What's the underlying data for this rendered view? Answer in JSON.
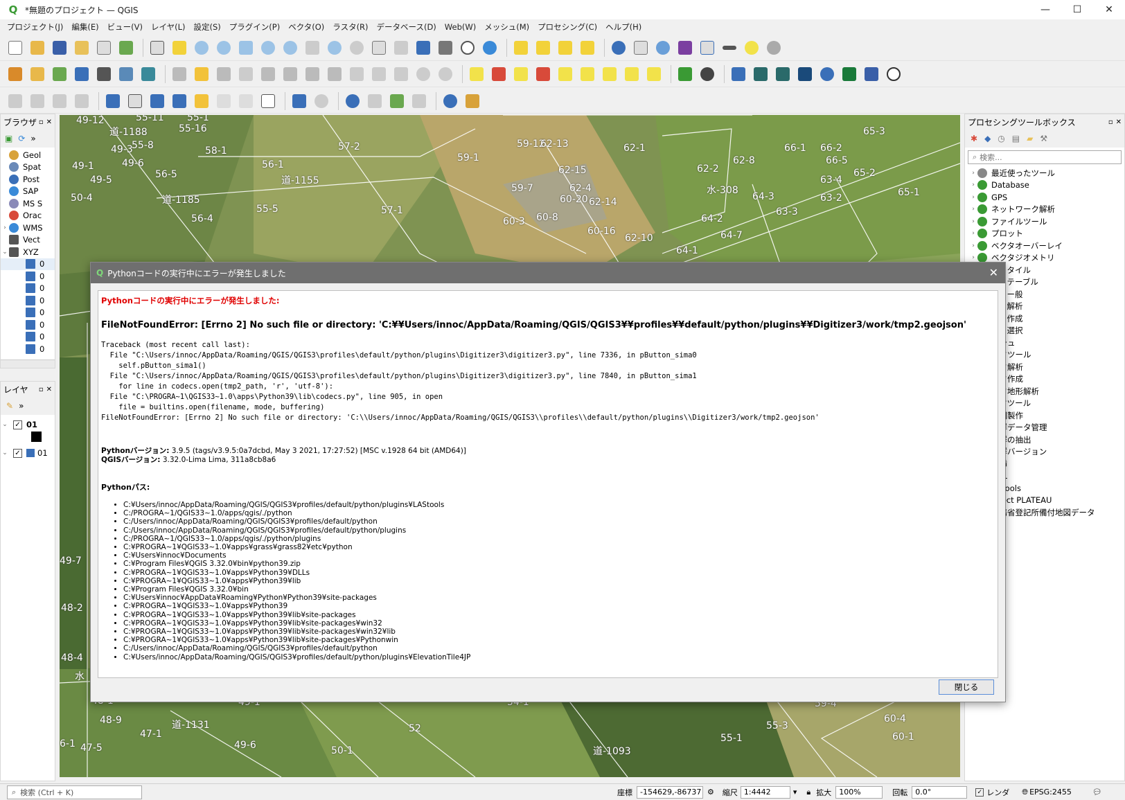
{
  "window": {
    "title": "*無題のプロジェクト — QGIS",
    "minimize": "—",
    "maximize": "☐",
    "close": "✕"
  },
  "menu": [
    "プロジェクト(J)",
    "編集(E)",
    "ビュー(V)",
    "レイヤ(L)",
    "設定(S)",
    "プラグイン(P)",
    "ベクタ(O)",
    "ラスタ(R)",
    "データベース(D)",
    "Web(W)",
    "メッシュ(M)",
    "プロセシング(C)",
    "ヘルプ(H)"
  ],
  "browser": {
    "title": "ブラウザ",
    "items": [
      "Geol",
      "Spat",
      "Post",
      "SAP",
      "MS S",
      "Orac",
      "WMS",
      "Vect",
      "XYZ"
    ],
    "xyz_children": [
      "0",
      "0",
      "0",
      "0",
      "0",
      "0",
      "0",
      "0"
    ]
  },
  "layers": {
    "title": "レイヤ",
    "items": [
      "01",
      "01"
    ]
  },
  "processing": {
    "title": "プロセシングツールボックス",
    "search_placeholder": "検索...",
    "items": [
      "最近使ったツール",
      "Database",
      "GPS",
      "ネットワーク解析",
      "ファイルツール",
      "プロット",
      "ベクタオーバーレイ",
      "ベクタジオメトリ",
      "クタタイル",
      "クタテーブル",
      "クター般",
      "クタ解析",
      "クタ作成",
      "クタ選択",
      "ッシュ",
      "スタツール",
      "スタ解析",
      "スタ作成",
      "スタ地形解析",
      "イヤツール",
      "地図製作",
      "点群データ管理",
      "点群の抽出",
      "点群バージョン",
      "内挿",
      "DAL",
      "AStools",
      "roject PLATEAU",
      "法務省登記所備付地図データ"
    ]
  },
  "map_labels": [
    "49-12",
    "道-1188",
    "55-11",
    "55-1",
    "55-16",
    "49-3",
    "55-8",
    "58-1",
    "57-2",
    "59-1",
    "59-12",
    "62-13",
    "62-1",
    "66-1",
    "66-2",
    "65-3",
    "49-1",
    "49-6",
    "56-1",
    "49-5",
    "56-5",
    "道-1155",
    "62-15",
    "62-2",
    "62-8",
    "66-5",
    "65-2",
    "59-7",
    "62-4",
    "水-308",
    "64-3",
    "63-4",
    "65-1",
    "50-4",
    "道-1185",
    "55-5",
    "57-1",
    "60-20",
    "62-14",
    "63-2",
    "63-3",
    "56-4",
    "60-3",
    "60-8",
    "60-16",
    "64-2",
    "62-10",
    "64-7",
    "64-1",
    "49-7",
    "48-2",
    "48-4",
    "水",
    "48-1",
    "49-1",
    "道-1079",
    "56-2",
    "54-1",
    "59-3",
    "59-4",
    "48-9",
    "47-1",
    "道-1131",
    "52",
    "55-3",
    "60-4",
    "55-1",
    "60-1",
    "49-6",
    "6-1",
    "47-5",
    "50-1",
    "道-1093"
  ],
  "dialog": {
    "title": "Pythonコードの実行中にエラーが発生しました",
    "header": "Pythonコードの実行中にエラーが発生しました:",
    "error": "FileNotFoundError: [Errno 2] No such file or directory: 'C:¥¥Users/innoc/AppData/Roaming/QGIS/QGIS3¥¥profiles¥¥default/python/plugins¥¥Digitizer3/work/tmp2.geojson'",
    "traceback": "Traceback (most recent call last):\n  File \"C:\\Users/innoc/AppData/Roaming/QGIS/QGIS3\\profiles\\default/python/plugins\\Digitizer3\\digitizer3.py\", line 7336, in pButton_sima0\n    self.pButton_sima1()\n  File \"C:\\Users/innoc/AppData/Roaming/QGIS/QGIS3\\profiles\\default/python/plugins\\Digitizer3\\digitizer3.py\", line 7840, in pButton_sima1\n    for line in codecs.open(tmp2_path, 'r', 'utf-8'):\n  File \"C:\\PROGRA~1\\QGIS33~1.0\\apps\\Python39\\lib\\codecs.py\", line 905, in open\n    file = builtins.open(filename, mode, buffering)\nFileNotFoundError: [Errno 2] No such file or directory: 'C:\\\\Users/innoc/AppData/Roaming/QGIS/QGIS3\\\\profiles\\\\default/python/plugins\\\\Digitizer3/work/tmp2.geojson'",
    "python_version_label": "Pythonバージョン:",
    "python_version": "3.9.5 (tags/v3.9.5:0a7dcbd, May  3 2021, 17:27:52) [MSC v.1928 64 bit (AMD64)]",
    "qgis_version_label": "QGISバージョン:",
    "qgis_version": "3.32.0-Lima Lima, 311a8cb8a6",
    "python_path_label": "Pythonパス:",
    "python_paths": [
      "C:¥Users/innoc/AppData/Roaming/QGIS/QGIS3¥profiles/default/python/plugins¥LAStools",
      "C:/PROGRA~1/QGIS33~1.0/apps/qgis/./python",
      "C:/Users/innoc/AppData/Roaming/QGIS/QGIS3¥profiles/default/python",
      "C:/Users/innoc/AppData/Roaming/QGIS/QGIS3¥profiles/default/python/plugins",
      "C:/PROGRA~1/QGIS33~1.0/apps/qgis/./python/plugins",
      "C:¥PROGRA~1¥QGIS33~1.0¥apps¥grass¥grass82¥etc¥python",
      "C:¥Users¥innoc¥Documents",
      "C:¥Program Files¥QGIS 3.32.0¥bin¥python39.zip",
      "C:¥PROGRA~1¥QGIS33~1.0¥apps¥Python39¥DLLs",
      "C:¥PROGRA~1¥QGIS33~1.0¥apps¥Python39¥lib",
      "C:¥Program Files¥QGIS 3.32.0¥bin",
      "C:¥Users¥innoc¥AppData¥Roaming¥Python¥Python39¥site-packages",
      "C:¥PROGRA~1¥QGIS33~1.0¥apps¥Python39",
      "C:¥PROGRA~1¥QGIS33~1.0¥apps¥Python39¥lib¥site-packages",
      "C:¥PROGRA~1¥QGIS33~1.0¥apps¥Python39¥lib¥site-packages¥win32",
      "C:¥PROGRA~1¥QGIS33~1.0¥apps¥Python39¥lib¥site-packages¥win32¥lib",
      "C:¥PROGRA~1¥QGIS33~1.0¥apps¥Python39¥lib¥site-packages¥Pythonwin",
      "C:/Users/innoc/AppData/Roaming/QGIS/QGIS3¥profiles/default/python",
      "C:¥Users/innoc/AppData/Roaming/QGIS/QGIS3¥profiles/default/python/plugins¥ElevationTile4JP"
    ],
    "close_button": "閉じる",
    "title_close": "✕"
  },
  "status": {
    "search_placeholder": "検索 (Ctrl + K)",
    "coord_label": "座標",
    "coord_value": "-154629,-86737",
    "scale_label": "縮尺",
    "scale_value": "1:4442",
    "zoom_label": "拡大",
    "zoom_value": "100%",
    "rotation_label": "回転",
    "rotation_value": "0.0°",
    "render_label": "レンダ",
    "crs": "EPSG:2455"
  },
  "colors": {
    "accent": "#3a9a34",
    "error_red": "#e00000",
    "dialog_title": "#6f6f6f"
  }
}
